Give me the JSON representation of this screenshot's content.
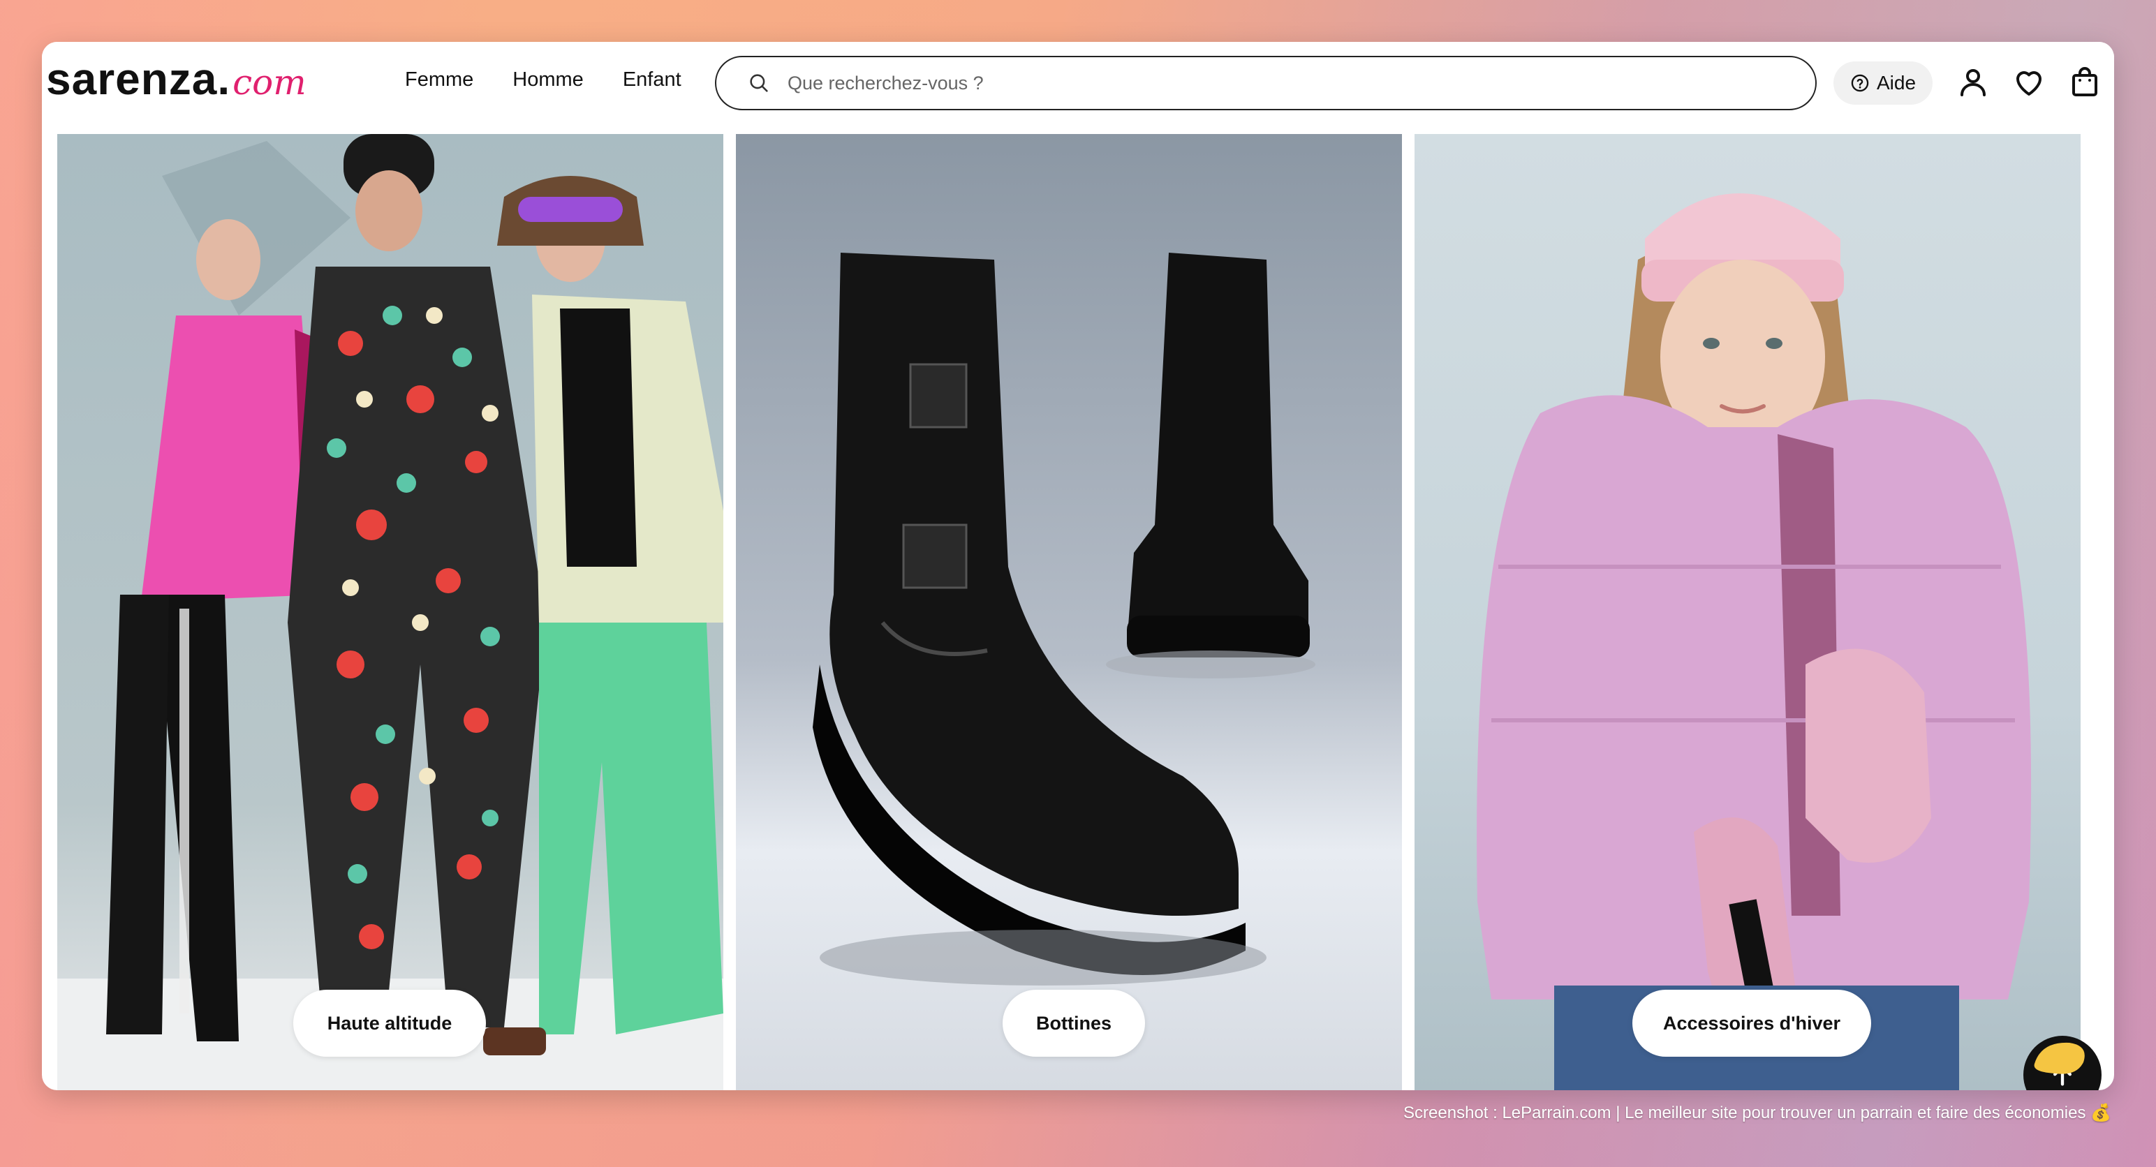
{
  "brand": {
    "name": "sarenza",
    "dot": ".",
    "suffix": "com"
  },
  "nav": {
    "items": [
      "Femme",
      "Homme",
      "Enfant"
    ]
  },
  "search": {
    "placeholder": "Que recherchez-vous ?"
  },
  "header": {
    "help_label": "Aide"
  },
  "icons": {
    "search": "search-icon",
    "help": "question-circle-icon",
    "account": "user-icon",
    "wishlist": "heart-icon",
    "cart": "shopping-bag-icon",
    "scroll_top": "arrow-up-icon"
  },
  "tiles": [
    {
      "label": "Haute altitude"
    },
    {
      "label": "Bottines"
    },
    {
      "label": "Accessoires d'hiver"
    }
  ],
  "colors": {
    "brand_accent": "#e0206e",
    "text": "#111111",
    "pill_bg": "#ffffff"
  },
  "footer_caption": "Screenshot : LeParrain.com | Le meilleur site pour trouver un parrain et faire des économies 💰"
}
